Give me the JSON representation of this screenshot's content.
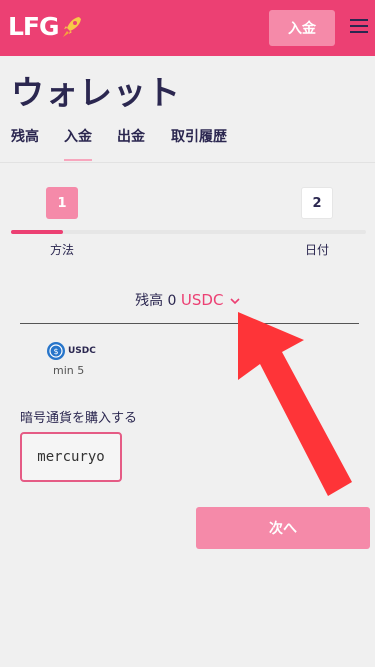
{
  "header": {
    "logo_text": "LFG",
    "deposit_button_label": "入金",
    "brand_color": "#ec4073"
  },
  "page": {
    "title": "ウォレット"
  },
  "tabs": [
    {
      "label": "残高",
      "active": false
    },
    {
      "label": "入金",
      "active": true
    },
    {
      "label": "出金",
      "active": false
    },
    {
      "label": "取引履歴",
      "active": false
    }
  ],
  "stepper": {
    "progress": 0.15,
    "steps": [
      {
        "number": "1",
        "label": "方法",
        "active": true
      },
      {
        "number": "2",
        "label": "日付",
        "active": false
      }
    ]
  },
  "balance": {
    "label": "残高",
    "amount": "0",
    "currency": "USDC"
  },
  "coin": {
    "name": "USDC",
    "min": "min 5",
    "icon": "usdc-coin-icon"
  },
  "buy_crypto": {
    "title": "暗号通貨を購入する",
    "provider": "mercuryo"
  },
  "next_button_label": "次へ",
  "annotation": {
    "arrow_color": "#fe3438"
  }
}
